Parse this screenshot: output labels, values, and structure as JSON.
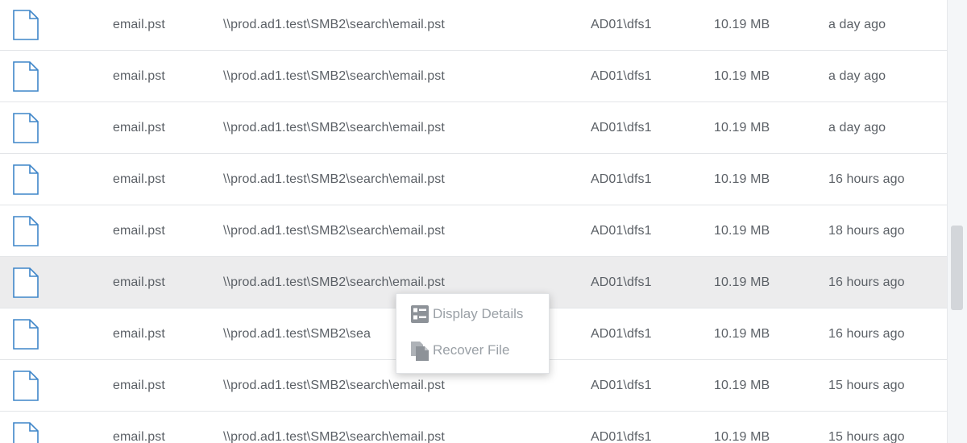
{
  "rows": [
    {
      "name": "email.pst",
      "path": "\\\\prod.ad1.test\\SMB2\\search\\email.pst",
      "server": "AD01\\dfs1",
      "size": "10.19 MB",
      "modified": "a day ago"
    },
    {
      "name": "email.pst",
      "path": "\\\\prod.ad1.test\\SMB2\\search\\email.pst",
      "server": "AD01\\dfs1",
      "size": "10.19 MB",
      "modified": "a day ago"
    },
    {
      "name": "email.pst",
      "path": "\\\\prod.ad1.test\\SMB2\\search\\email.pst",
      "server": "AD01\\dfs1",
      "size": "10.19 MB",
      "modified": "a day ago"
    },
    {
      "name": "email.pst",
      "path": "\\\\prod.ad1.test\\SMB2\\search\\email.pst",
      "server": "AD01\\dfs1",
      "size": "10.19 MB",
      "modified": "16 hours ago"
    },
    {
      "name": "email.pst",
      "path": "\\\\prod.ad1.test\\SMB2\\search\\email.pst",
      "server": "AD01\\dfs1",
      "size": "10.19 MB",
      "modified": "18 hours ago"
    },
    {
      "name": "email.pst",
      "path": "\\\\prod.ad1.test\\SMB2\\search\\email.pst",
      "server": "AD01\\dfs1",
      "size": "10.19 MB",
      "modified": "16 hours ago"
    },
    {
      "name": "email.pst",
      "path": "\\\\prod.ad1.test\\SMB2\\sea",
      "server": "AD01\\dfs1",
      "size": "10.19 MB",
      "modified": "16 hours ago"
    },
    {
      "name": "email.pst",
      "path": "\\\\prod.ad1.test\\SMB2\\search\\email.pst",
      "server": "AD01\\dfs1",
      "size": "10.19 MB",
      "modified": "15 hours ago"
    },
    {
      "name": "email.pst",
      "path": "\\\\prod.ad1.test\\SMB2\\search\\email.pst",
      "server": "AD01\\dfs1",
      "size": "10.19 MB",
      "modified": "15 hours ago"
    }
  ],
  "highlighted_row": 5,
  "context_menu": {
    "items": [
      {
        "label": "Display Details",
        "icon": "details-list-icon"
      },
      {
        "label": "Recover File",
        "icon": "copy-file-icon"
      }
    ]
  },
  "colors": {
    "file_icon_stroke": "#3f86c9",
    "highlight_row": "#ececed",
    "menu_text": "#9aa0a6",
    "menu_icon": "#8d9298"
  }
}
